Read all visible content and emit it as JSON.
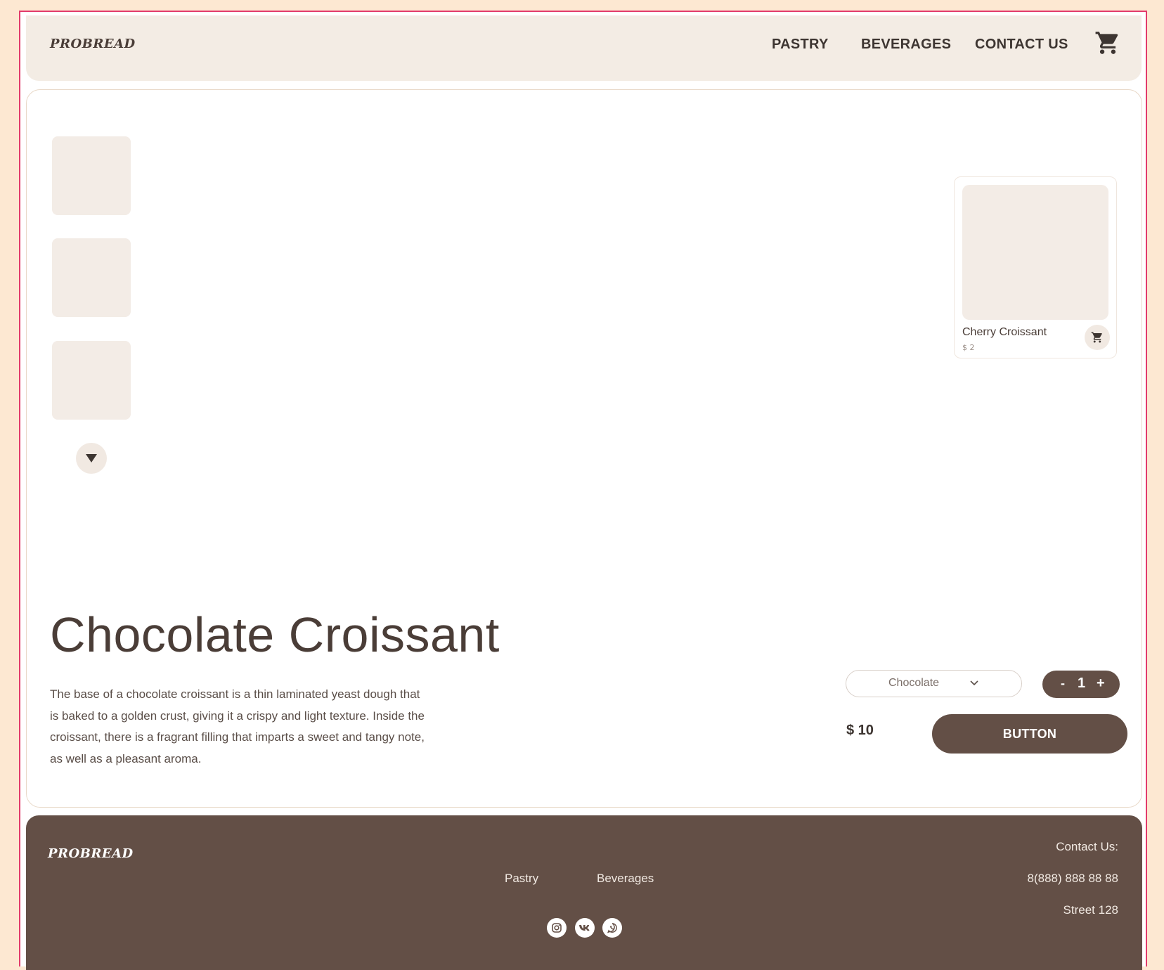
{
  "brand": "PROBREAD",
  "nav": {
    "pastry": "PASTRY",
    "beverages": "BEVERAGES",
    "contact": "CONTACT US"
  },
  "recommended": {
    "name": "Cherry Croissant",
    "price": "$ 2"
  },
  "product": {
    "title": "Chocolate Croissant",
    "description": "The base of a chocolate croissant is a thin laminated yeast dough that is baked to a golden crust, giving it a crispy and light texture. Inside the croissant, there is a fragrant filling that imparts a sweet and tangy note, as well as a pleasant aroma.",
    "flavor": "Chocolate",
    "quantity": "1",
    "minus": "-",
    "plus": "+",
    "price": "$ 10",
    "button": "BUTTON"
  },
  "footer": {
    "brand": "PROBREAD",
    "links": {
      "pastry": "Pastry",
      "beverages": "Beverages"
    },
    "contact_title": "Contact Us:",
    "phone": "8(888) 888 88 88",
    "address": "Street 128",
    "social_icons": [
      "instagram-icon",
      "vk-icon",
      "whatsapp-icon"
    ]
  },
  "colors": {
    "background": "#fde8d2",
    "accent": "#634f46",
    "surface": "#f3ece4",
    "frame": "#e23b6b"
  }
}
